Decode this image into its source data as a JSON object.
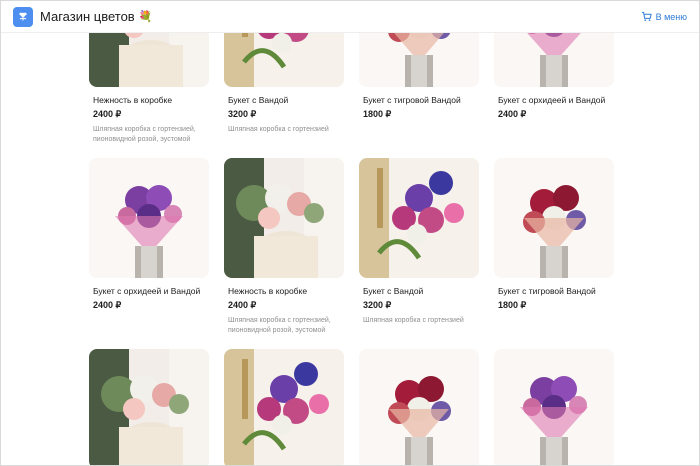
{
  "header": {
    "title": "Магазин цветов",
    "flower_icon": "flower-emoji-icon",
    "cart_label": "В меню"
  },
  "colors": {
    "accent": "#2e7bd6",
    "logo": "#4d8ef0",
    "text": "#21201f",
    "muted": "#8f8f8f"
  },
  "products": [
    {
      "name": "Нежность в коробке",
      "price": "2400 ₽",
      "desc": "Шляпная коробка с гортензией, пионовидной розой, эустомой",
      "image": "box"
    },
    {
      "name": "Букет с Вандой",
      "price": "3200 ₽",
      "desc": "Шляпная коробка с гортензией",
      "image": "vanda"
    },
    {
      "name": "Букет с тигровой Вандой",
      "price": "1800 ₽",
      "desc": "",
      "image": "tiger"
    },
    {
      "name": "Букет с орхидеей и Вандой",
      "price": "2400 ₽",
      "desc": "",
      "image": "orchid"
    },
    {
      "name": "Букет с орхидеей и Вандой",
      "price": "2400 ₽",
      "desc": "",
      "image": "orchid"
    },
    {
      "name": "Нежность в коробке",
      "price": "2400 ₽",
      "desc": "Шляпная коробка с гортензией, пионовидной розой, эустомой",
      "image": "box"
    },
    {
      "name": "Букет с Вандой",
      "price": "3200 ₽",
      "desc": "Шляпная коробка с гортензией",
      "image": "vanda"
    },
    {
      "name": "Букет с тигровой Вандой",
      "price": "1800 ₽",
      "desc": "",
      "image": "tiger"
    },
    {
      "name": "",
      "price": "",
      "desc": "",
      "image": "box"
    },
    {
      "name": "",
      "price": "",
      "desc": "",
      "image": "vanda"
    },
    {
      "name": "",
      "price": "",
      "desc": "",
      "image": "tiger"
    },
    {
      "name": "",
      "price": "",
      "desc": "",
      "image": "orchid"
    }
  ]
}
